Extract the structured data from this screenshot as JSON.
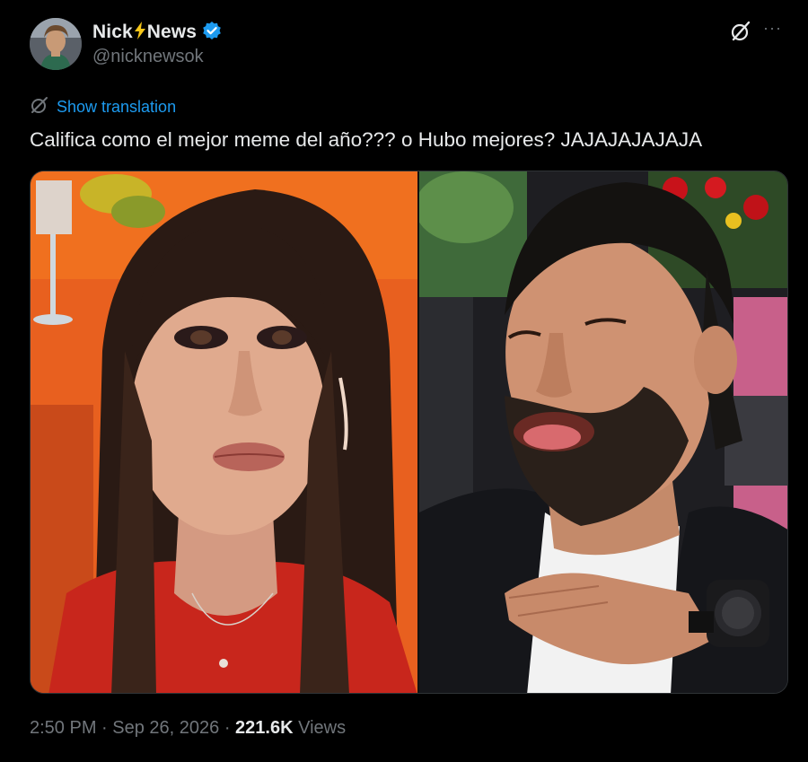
{
  "author": {
    "name_part1": "Nick",
    "name_part2": "News",
    "handle": "@nicknewsok",
    "verified": true
  },
  "actions": {
    "grok_icon": "grok-slash-icon",
    "more_label": "···"
  },
  "translation": {
    "label": "Show translation"
  },
  "tweet": {
    "text": "Califica como el mejor meme del año??? o Hubo mejores? JAJAJAJAJAJA"
  },
  "meta": {
    "time": "2:50 PM",
    "sep1": " · ",
    "date": "Sep 26, 2026",
    "sep2": " · ",
    "views_count": "221.6K",
    "views_label": " Views"
  },
  "colors": {
    "background": "#000000",
    "text_primary": "#e7e9ea",
    "text_secondary": "#71767b",
    "link": "#1d9bf0",
    "verified": "#1d9bf0",
    "bolt": "#f5c518"
  }
}
